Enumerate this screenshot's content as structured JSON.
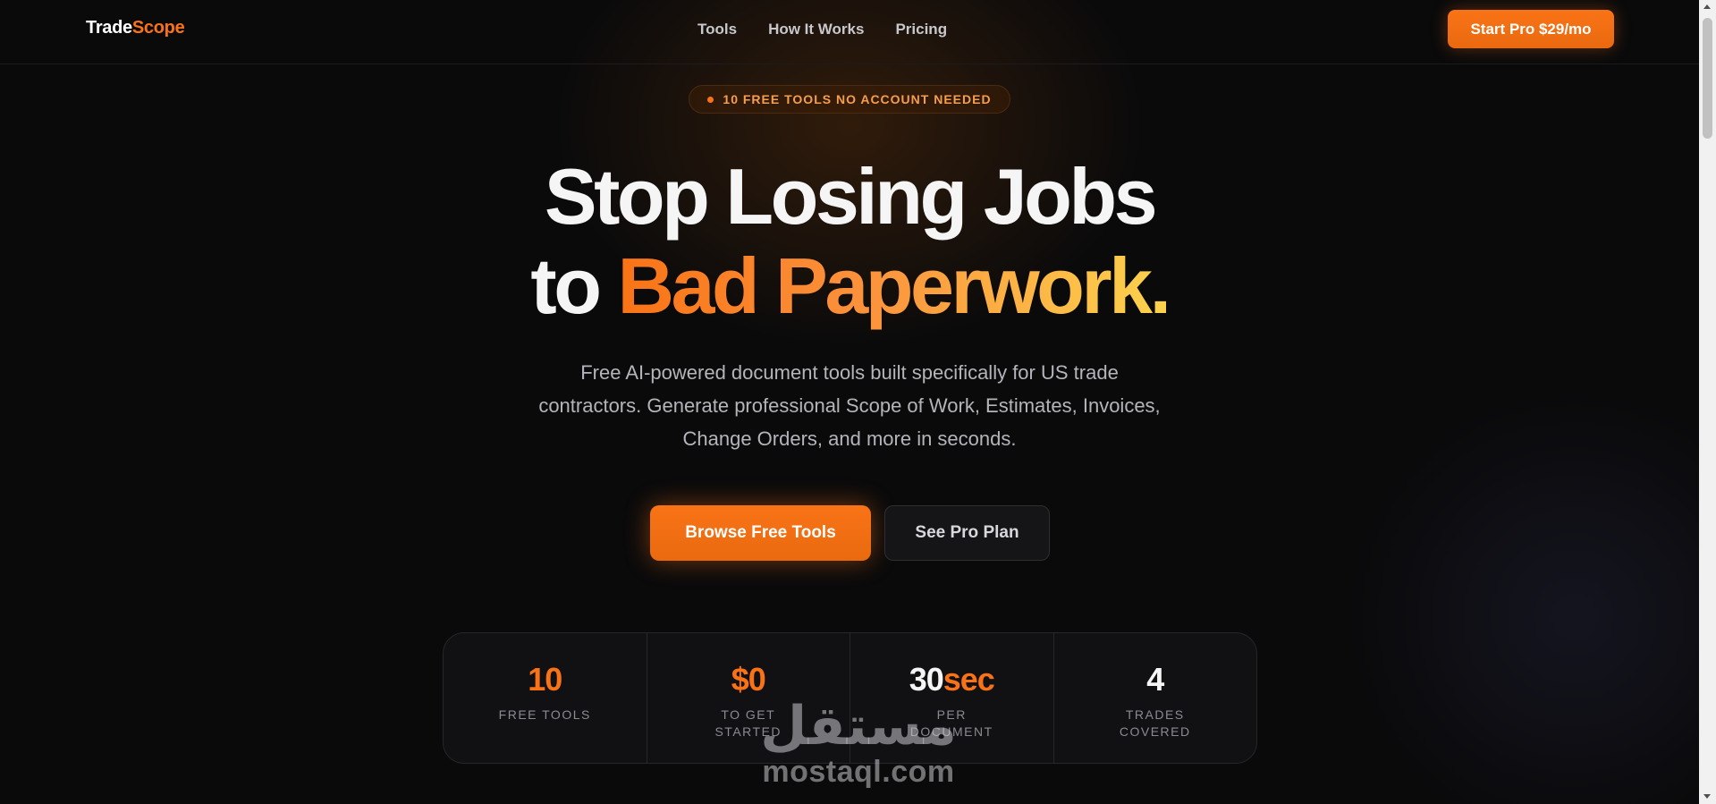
{
  "nav": {
    "logo_part1": "Trade",
    "logo_part2": "Scope",
    "links": [
      "Tools",
      "How It Works",
      "Pricing"
    ],
    "cta_label": "Start Pro $29/mo"
  },
  "badge": {
    "text": "10 FREE TOOLS NO ACCOUNT NEEDED"
  },
  "hero": {
    "line1": "Stop Losing Jobs",
    "line2_plain": "to ",
    "line2_highlight": "Bad Paperwork.",
    "subtitle": "Free AI-powered document tools built specifically for US trade contractors. Generate professional Scope of Work, Estimates, Invoices, Change Orders, and more in seconds.",
    "primary_button": "Browse Free Tools",
    "secondary_button": "See Pro Plan"
  },
  "stats": [
    {
      "value_main": "10",
      "value_suffix": "",
      "label": "FREE TOOLS"
    },
    {
      "value_main": "$0",
      "value_suffix": "",
      "label": "TO GET STARTED"
    },
    {
      "value_main": "30",
      "value_suffix": "sec",
      "label": "PER DOCUMENT"
    },
    {
      "value_main": "4",
      "value_suffix": "",
      "label": "TRADES COVERED"
    }
  ],
  "watermark": {
    "arabic": "مستقل",
    "latin": "mostaql.com"
  },
  "colors": {
    "accent": "#f97316",
    "gradient_end": "#fcd34d",
    "background": "#0a0a0b"
  }
}
